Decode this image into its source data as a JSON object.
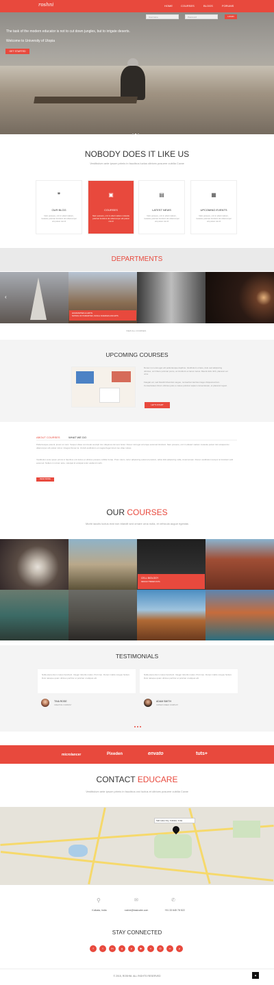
{
  "header": {
    "logo": "roshni",
    "nav": [
      "HOME",
      "COURSES",
      "BLOGS",
      "FORUMS"
    ],
    "search_placeholder": "Username",
    "password_placeholder": "Password",
    "login": "LOGIN"
  },
  "hero": {
    "line1": "The task of the modern educator is not to cut down jungles, but to irrigate deserts.",
    "line2": "Welcome to University of Utopia",
    "button": "GET STARTED"
  },
  "features": {
    "title": "NOBODY DOES IT LIKE US",
    "subtitle": "Vestibulum ante ipsum primis in faucibus luctus ultrices posuere cubilia Curae",
    "cards": [
      {
        "title": "OUR BLOG",
        "text": "Nam posuere, orci in elled mattum, molestie pulvinar tincidunt dui ullamcorper elit pulvar nisi dl"
      },
      {
        "title": "COURSES",
        "text": "Nam posuere, orci in elled mattum molestie pulvinar tincidunt dui ullamcorper elit pulvar nisi dl"
      },
      {
        "title": "LATEST NEWS",
        "text": "Nam posuere, orci in elled mattum, molestie pulvinar tincidunt dui ullamcorper elit pulvar nisi dl"
      },
      {
        "title": "UPCOMING EVENTS",
        "text": "Nam posuere, orci in elled mattum, molestie pulvinar tincidunt dui ullamcorper elit pulvar nisi dl"
      }
    ]
  },
  "departments": {
    "title": "DEPARTMENTS",
    "label1": "HUMANITIES & ARTS",
    "label2": "SCHOOL OF HUMANITIES, SOCIAL SCIENCES AND ARTS",
    "view_all": "VIEW ALL COURSES"
  },
  "upcoming": {
    "title": "UPCOMING COURSES",
    "para1": "Donec non erat eget elit pellentesque dapibus. Vestibulum ornare, dolo sed adipiscing ultricies, orci libero pulvinar purus, ac tincidunt ex lacus metus. Mauris felis nibh, placerat vel urna.",
    "para2": "Faugiat vel, sed blandit bibendum augue, nunwertian lacinia integer Aliquamsd.loro ConsectetaeL Drud. ultricies justo a mares pulvinar sapien consectetuan, et placerat rugest.",
    "button": "LET'S START"
  },
  "about": {
    "tab1": "ABOUT COURSES",
    "tab2": "WHAT WE DO",
    "para1": "Pellentesque potenti, ipsum et nunc. Suspen disse commodo suscipit nisi. Aliquima nisi sem ferter. Donec nisl eget at torque euismod tincidunt. Nam posuere, orci in elleted mattum molestie pulvar nisl volutpat dui ullamcorper elit pulvar nisl et. Integss Donec la. Ut dull vestibulum et magna fieget lorem leo vitae rulusp.",
    "para2": "Vestibulum ante ipsum primis in faucibus orci luctus et ultrices posuere cubilia Curae. Proin rutum, tortor adipiscing euismod pretium, tellus felis adipiscing nulla, id accumsan. Donec vestibulum tempor at tincidunt velit euismod. Nullam in rutrum ante, volutpat id volutpat tortor eleifend morbi.",
    "button": "READ MORE"
  },
  "courses": {
    "title_plain": "OUR ",
    "title_accent": "COURSES",
    "subtitle": "Morbi iaculis luctus erat non blandit sed ornare urna nulla, et vehicula augue egestas",
    "highlight_title": "CELL BIOLOGY",
    "highlight_sub": "DESIGN THEMES DATA"
  },
  "testimonials": {
    "title": "TESTIMONIALS",
    "items": [
      {
        "quote": "Nulla elementum metus hendrerit. Integer lobortis matus. Proin leo. Donec mattis congue hodem. Duis natoque quam ultrices porrtitor et pulvinar ut aliquet elit.",
        "name": "TINA ROSE",
        "role": "CREATIVE COMPANY"
      },
      {
        "quote": "Nulla elementum metus hendrerit. Integer lobortis matus. Proin leo. Donec mattis congue hodem. Duis natoque quam ultrices porrtitor et pulvinar ut aliquet elit.",
        "name": "ADAM SMITH",
        "role": "OWNER CREED COMPANY"
      }
    ]
  },
  "partners": [
    "microlancer",
    "Pixeden",
    "envato",
    "tuts+"
  ],
  "contact": {
    "title_plain": "CONTACT ",
    "title_accent": "EDUCARE",
    "subtitle": "Vestibulum ante ipsum primis in faucibus orci luctus et ultrices posuere cubilia Curae",
    "map_label": "Salt Lake City, Kolkata, India",
    "location": "Kolkata, India",
    "email": "roshni@basicabe.com",
    "phone": "+91 33 645 78 522"
  },
  "stay_connected": "STAY CONNECTED",
  "footer": {
    "copyright": "© 2015, ROSHNI. ALL RIGHTS RESERVED",
    "top_icon": "▲"
  }
}
